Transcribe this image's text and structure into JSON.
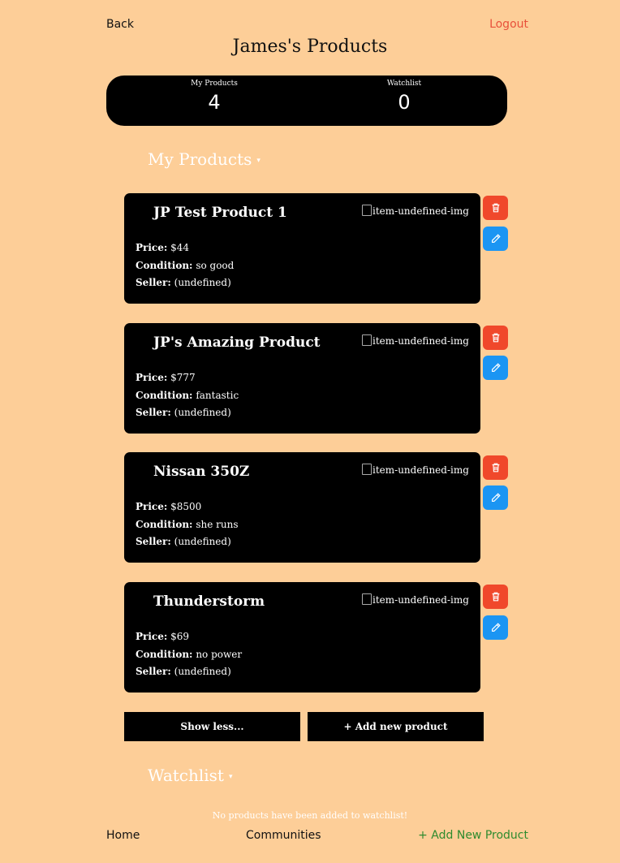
{
  "nav": {
    "back": "Back",
    "logout": "Logout"
  },
  "page_title": "James's Products",
  "stats": {
    "my_products_label": "My Products",
    "my_products_count": "4",
    "watchlist_label": "Watchlist",
    "watchlist_count": "0"
  },
  "my_products_header": "My Products",
  "watchlist_header": "Watchlist",
  "caret": "▾",
  "labels": {
    "price": "Price:",
    "condition": "Condition:",
    "seller": "Seller:"
  },
  "products": [
    {
      "name": "JP Test Product 1",
      "img_alt": "item-undefined-img",
      "price": "$44",
      "condition": "so good",
      "seller": "(undefined)"
    },
    {
      "name": "JP's Amazing Product",
      "img_alt": "item-undefined-img",
      "price": "$777",
      "condition": "fantastic",
      "seller": "(undefined)"
    },
    {
      "name": "Nissan 350Z",
      "img_alt": "item-undefined-img",
      "price": "$8500",
      "condition": "she runs",
      "seller": "(undefined)"
    },
    {
      "name": "Thunderstorm",
      "img_alt": "item-undefined-img",
      "price": "$69",
      "condition": "no power",
      "seller": "(undefined)"
    }
  ],
  "buttons": {
    "show_less": "Show less...",
    "add_new": "+ Add new product"
  },
  "watchlist_empty": "No products have been added to watchlist!",
  "footer": {
    "home": "Home",
    "communities": "Communities",
    "add_new_product": "+ Add New Product"
  },
  "colors": {
    "background": "#fdce98",
    "delete": "#f0482b",
    "edit": "#1b95f3",
    "logout": "#e8503a",
    "add_link": "#2e8b2e"
  },
  "icons": {
    "delete": "trash-icon",
    "edit": "pencil-icon",
    "image": "broken-image-icon"
  }
}
